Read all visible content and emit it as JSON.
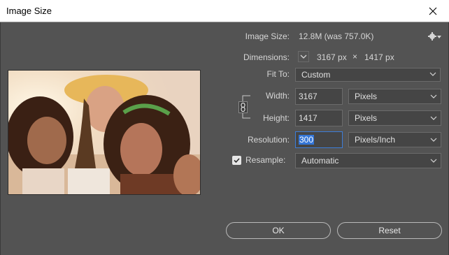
{
  "window": {
    "title": "Image Size"
  },
  "image_size": {
    "label": "Image Size:",
    "value": "12.8M (was 757.0K)"
  },
  "dimensions": {
    "label": "Dimensions:",
    "width": "3167 px",
    "times": "×",
    "height": "1417 px"
  },
  "fit_to": {
    "label": "Fit To:",
    "value": "Custom"
  },
  "width": {
    "label": "Width:",
    "value": "3167",
    "unit": "Pixels"
  },
  "height": {
    "label": "Height:",
    "value": "1417",
    "unit": "Pixels"
  },
  "resolution": {
    "label": "Resolution:",
    "value": "300",
    "unit": "Pixels/Inch"
  },
  "resample": {
    "label": "Resample:",
    "checked": true,
    "value": "Automatic"
  },
  "buttons": {
    "ok": "OK",
    "reset": "Reset"
  },
  "icons": {
    "close": "close-icon",
    "gear": "gear-icon",
    "chevron": "chevron-down-icon",
    "link": "chain-link-icon",
    "check": "checkmark-icon"
  },
  "colors": {
    "background": "#535353",
    "focus": "#3476d8"
  }
}
